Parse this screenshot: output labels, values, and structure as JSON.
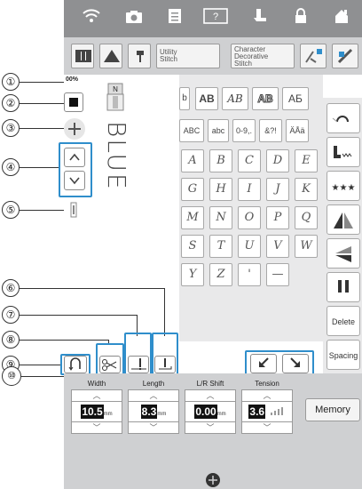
{
  "toolbar_icons": [
    "wifi-icon",
    "camera-icon",
    "document-icon",
    "help-icon",
    "presser-foot-icon",
    "lock-icon",
    "home-icon"
  ],
  "mode_bar": {
    "utility": "Utility\nStitch",
    "character": "Character\nDecorative\nStitch"
  },
  "canvas": {
    "size_label": "00%",
    "preview_text": "BLUE",
    "presser_foot_letter": "N"
  },
  "callouts": [
    "①",
    "②",
    "③",
    "④",
    "⑤",
    "⑥",
    "⑦",
    "⑧",
    "⑨",
    "⑩"
  ],
  "char_tabs": [
    "AB",
    "AB",
    "AB",
    "АБ"
  ],
  "char_filters": [
    "ABC",
    "abc",
    "0-9,.",
    "&?!",
    "ÄÅä"
  ],
  "char_keys": [
    [
      "A",
      "B",
      "C",
      "D",
      "E"
    ],
    [
      "G",
      "H",
      "I",
      "J",
      "K"
    ],
    [
      "M",
      "N",
      "O",
      "P",
      "Q"
    ],
    [
      "S",
      "T",
      "U",
      "V",
      "W"
    ],
    [
      "Y",
      "Z",
      "'",
      "—"
    ]
  ],
  "right_buttons": {
    "delete": "Delete",
    "spacing": "Spacing"
  },
  "params": [
    {
      "label": "Width",
      "value": "10.5",
      "unit": "mm"
    },
    {
      "label": "Length",
      "value": "8.3",
      "unit": "mm"
    },
    {
      "label": "L/R Shift",
      "value": "0.00",
      "unit": "mm"
    },
    {
      "label": "Tension",
      "value": "3.6",
      "unit": ""
    }
  ],
  "memory_label": "Memory",
  "colors": {
    "accent": "#2f8ecb",
    "panel": "#cfd0d2",
    "topbar": "#8f9092"
  }
}
